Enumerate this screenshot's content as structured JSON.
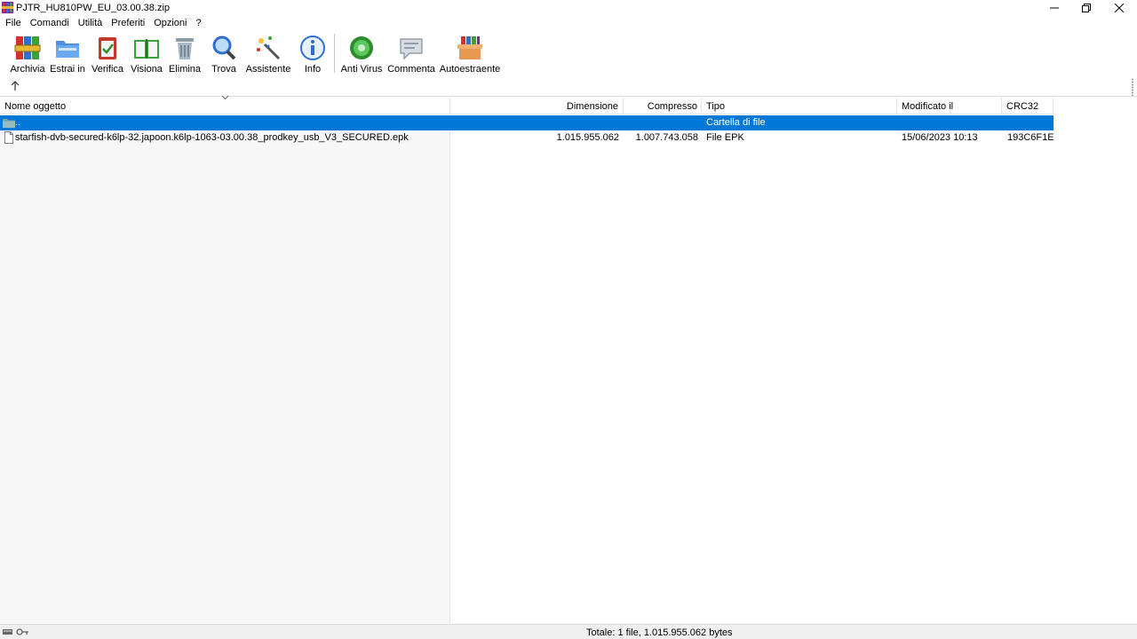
{
  "window": {
    "title": "PJTR_HU810PW_EU_03.00.38.zip"
  },
  "menu": [
    "File",
    "Comandi",
    "Utilità",
    "Preferiti",
    "Opzioni",
    "?"
  ],
  "toolbar": {
    "buttons": [
      {
        "label": "Archivia",
        "icon": "books-archive-icon"
      },
      {
        "label": "Estrai in",
        "icon": "folder-extract-icon"
      },
      {
        "label": "Verifica",
        "icon": "clipboard-check-icon"
      },
      {
        "label": "Visiona",
        "icon": "open-book-icon"
      },
      {
        "label": "Elimina",
        "icon": "trash-bin-icon"
      },
      {
        "label": "Trova",
        "icon": "magnifier-icon"
      },
      {
        "label": "Assistente",
        "icon": "magic-wand-icon"
      },
      {
        "label": "Info",
        "icon": "info-icon"
      },
      {
        "label": "Anti Virus",
        "icon": "antivirus-icon"
      },
      {
        "label": "Commenta",
        "icon": "comment-icon"
      },
      {
        "label": "Autoestraente",
        "icon": "sfx-box-icon"
      }
    ]
  },
  "columns": {
    "name": "Nome oggetto",
    "size": "Dimensione",
    "packed": "Compresso",
    "type": "Tipo",
    "modified": "Modificato il",
    "crc": "CRC32"
  },
  "rows": [
    {
      "name": "..",
      "size": "",
      "packed": "",
      "type": "Cartella di file",
      "modified": "",
      "crc": "",
      "icon": "folder-icon",
      "selected": true
    },
    {
      "name": "starfish-dvb-secured-k6lp-32.japoon.k6lp-1063-03.00.38_prodkey_usb_V3_SECURED.epk",
      "size": "1.015.955.062",
      "packed": "1.007.743.058",
      "type": "File EPK",
      "modified": "15/06/2023 10:13",
      "crc": "193C6F1E",
      "icon": "file-icon",
      "selected": false
    }
  ],
  "status": {
    "total": "Totale: 1 file, 1.015.955.062 bytes"
  },
  "colors": {
    "selection": "#0078d7"
  }
}
